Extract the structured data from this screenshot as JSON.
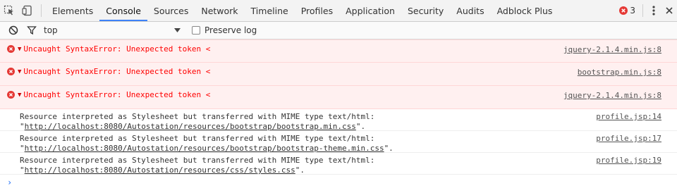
{
  "tabs": [
    "Elements",
    "Console",
    "Sources",
    "Network",
    "Timeline",
    "Profiles",
    "Application",
    "Security",
    "Audits",
    "Adblock Plus"
  ],
  "active_tab": "Console",
  "error_count": "3",
  "filter": {
    "context": "top",
    "preserve_log_label": "Preserve log",
    "preserve_log_checked": false
  },
  "errors": [
    {
      "message": "Uncaught SyntaxError: Unexpected token <",
      "source": "jquery-2.1.4.min.js:8"
    },
    {
      "message": "Uncaught SyntaxError: Unexpected token <",
      "source": "bootstrap.min.js:8"
    },
    {
      "message": "Uncaught SyntaxError: Unexpected token <",
      "source": "jquery-2.1.4.min.js:8"
    }
  ],
  "warnings": [
    {
      "prefix": "Resource interpreted as Stylesheet but transferred with MIME type text/html:",
      "url": "http://localhost:8080/Autostation/resources/bootstrap/bootstrap.min.css",
      "source": "profile.jsp:14"
    },
    {
      "prefix": "Resource interpreted as Stylesheet but transferred with MIME type text/html:",
      "url": "http://localhost:8080/Autostation/resources/bootstrap/bootstrap-theme.min.css",
      "source": "profile.jsp:17"
    },
    {
      "prefix": "Resource interpreted as Stylesheet but transferred with MIME type text/html:",
      "url": "http://localhost:8080/Autostation/resources/css/styles.css",
      "source": "profile.jsp:19"
    }
  ],
  "prompt_glyph": "›",
  "colors": {
    "error_text": "#ff0000",
    "error_bg": "#fff0f0",
    "accent": "#3e82f7",
    "error_icon": "#e53935"
  }
}
